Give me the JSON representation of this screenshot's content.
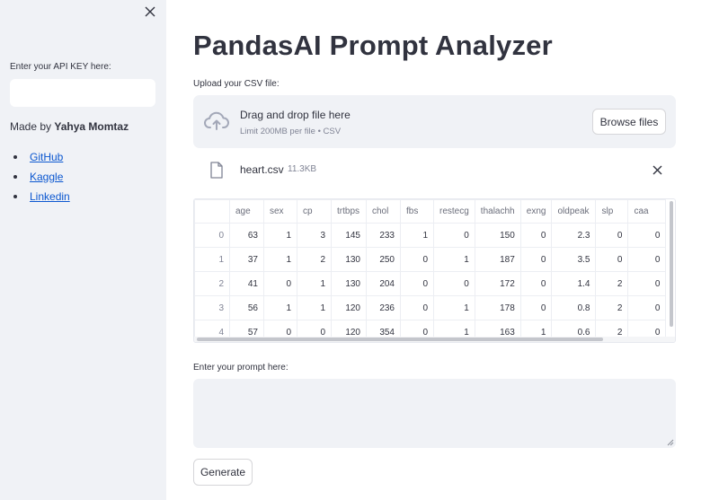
{
  "sidebar": {
    "api_label": "Enter your API KEY here:",
    "api_value": "",
    "made_by_prefix": "Made by",
    "made_by_name": "Yahya Momtaz",
    "links": [
      {
        "label": "GitHub"
      },
      {
        "label": "Kaggle"
      },
      {
        "label": "Linkedin"
      }
    ]
  },
  "main": {
    "title": "PandasAI Prompt Analyzer",
    "upload_label": "Upload your CSV file:",
    "dropzone": {
      "title": "Drag and drop file here",
      "subtitle": "Limit 200MB per file • CSV",
      "browse_label": "Browse files",
      "icon": "cloud-upload-icon"
    },
    "file": {
      "name": "heart.csv",
      "size": "11.3KB",
      "icon": "file-icon"
    },
    "table": {
      "columns": [
        "",
        "age",
        "sex",
        "cp",
        "trtbps",
        "chol",
        "fbs",
        "restecg",
        "thalachh",
        "exng",
        "oldpeak",
        "slp",
        "caa"
      ],
      "rows": [
        [
          "0",
          "63",
          "1",
          "3",
          "145",
          "233",
          "1",
          "0",
          "150",
          "0",
          "2.3",
          "0",
          "0"
        ],
        [
          "1",
          "37",
          "1",
          "2",
          "130",
          "250",
          "0",
          "1",
          "187",
          "0",
          "3.5",
          "0",
          "0"
        ],
        [
          "2",
          "41",
          "0",
          "1",
          "130",
          "204",
          "0",
          "0",
          "172",
          "0",
          "1.4",
          "2",
          "0"
        ],
        [
          "3",
          "56",
          "1",
          "1",
          "120",
          "236",
          "0",
          "1",
          "178",
          "0",
          "0.8",
          "2",
          "0"
        ],
        [
          "4",
          "57",
          "0",
          "0",
          "120",
          "354",
          "0",
          "1",
          "163",
          "1",
          "0.6",
          "2",
          "0"
        ]
      ]
    },
    "prompt_label": "Enter your prompt here:",
    "prompt_value": "",
    "generate_label": "Generate"
  },
  "colors": {
    "sidebar_bg": "#f0f2f6",
    "text": "#31333f",
    "link": "#0b57d0",
    "muted": "#808495"
  }
}
